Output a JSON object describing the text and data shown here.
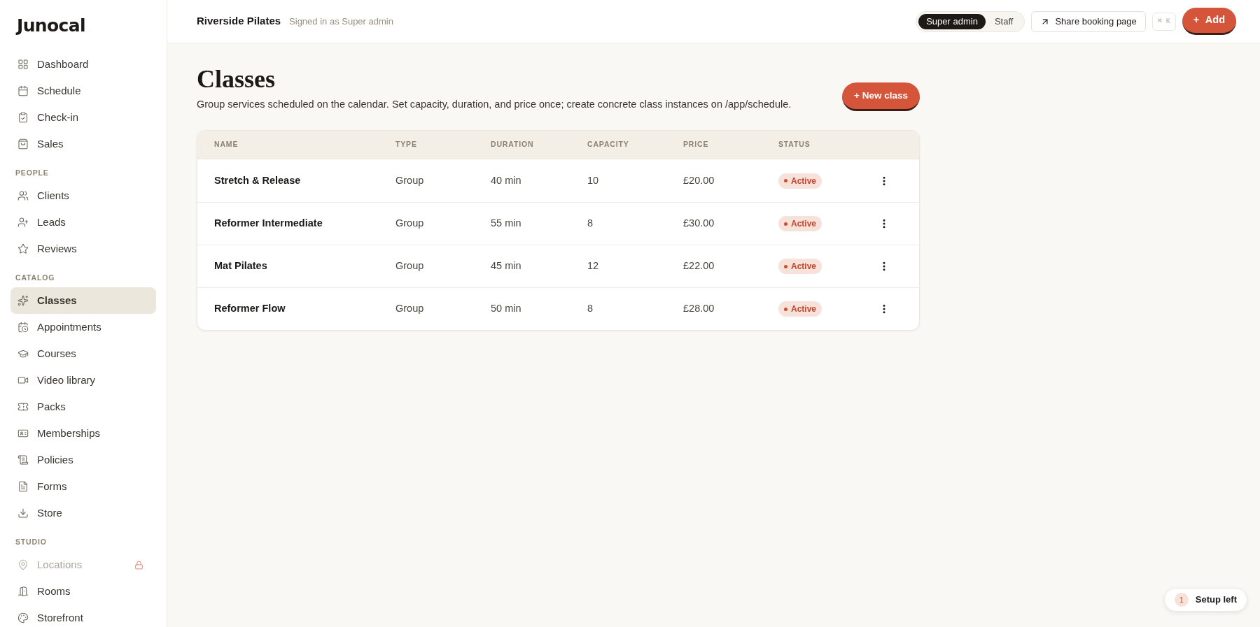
{
  "sidebar": {
    "logo": "Junocal",
    "sections": [
      {
        "items": [
          {
            "label": "Dashboard",
            "selected": false,
            "disabled": false,
            "locked": false
          },
          {
            "label": "Schedule",
            "selected": false,
            "disabled": false,
            "locked": false
          },
          {
            "label": "Check-in",
            "selected": false,
            "disabled": false,
            "locked": false
          },
          {
            "label": "Sales",
            "selected": false,
            "disabled": false,
            "locked": false
          }
        ]
      },
      {
        "title": "PEOPLE",
        "items": [
          {
            "label": "Clients",
            "selected": false,
            "disabled": false,
            "locked": false
          },
          {
            "label": "Leads",
            "selected": false,
            "disabled": false,
            "locked": false
          },
          {
            "label": "Reviews",
            "selected": false,
            "disabled": false,
            "locked": false
          }
        ]
      },
      {
        "title": "CATALOG",
        "items": [
          {
            "label": "Classes",
            "selected": true,
            "disabled": false,
            "locked": false
          },
          {
            "label": "Appointments",
            "selected": false,
            "disabled": false,
            "locked": false
          },
          {
            "label": "Courses",
            "selected": false,
            "disabled": false,
            "locked": false
          },
          {
            "label": "Video library",
            "selected": false,
            "disabled": false,
            "locked": false
          },
          {
            "label": "Packs",
            "selected": false,
            "disabled": false,
            "locked": false
          },
          {
            "label": "Memberships",
            "selected": false,
            "disabled": false,
            "locked": false
          },
          {
            "label": "Policies",
            "selected": false,
            "disabled": false,
            "locked": false
          },
          {
            "label": "Forms",
            "selected": false,
            "disabled": false,
            "locked": false
          },
          {
            "label": "Store",
            "selected": false,
            "disabled": false,
            "locked": false
          }
        ]
      },
      {
        "title": "STUDIO",
        "items": [
          {
            "label": "Locations",
            "selected": false,
            "disabled": true,
            "locked": true
          },
          {
            "label": "Rooms",
            "selected": false,
            "disabled": false,
            "locked": false
          },
          {
            "label": "Storefront",
            "selected": false,
            "disabled": false,
            "locked": false
          }
        ]
      }
    ]
  },
  "header": {
    "studio_name": "Riverside Pilates",
    "signed_in": "Signed in as Super admin",
    "roles": [
      {
        "label": "Super admin",
        "selected": true
      },
      {
        "label": "Staff",
        "selected": false
      }
    ],
    "share_button": "Share booking page",
    "shortcut": "⌘ K",
    "add_button": "+ Add"
  },
  "page": {
    "title": "Classes",
    "description": "Group services scheduled on the calendar. Set capacity, duration, and price once; create concrete class instances on /app/schedule.",
    "new_class_button": "+ New class"
  },
  "table": {
    "columns": [
      "NAME",
      "TYPE",
      "DURATION",
      "CAPACITY",
      "PRICE",
      "STATUS"
    ],
    "rows": [
      {
        "name": "Stretch & Release",
        "type": "Group",
        "duration": "40 min",
        "capacity": "10",
        "price": "£20.00",
        "status": "Active"
      },
      {
        "name": "Reformer Intermediate",
        "type": "Group",
        "duration": "55 min",
        "capacity": "8",
        "price": "£30.00",
        "status": "Active"
      },
      {
        "name": "Mat Pilates",
        "type": "Group",
        "duration": "45 min",
        "capacity": "12",
        "price": "£22.00",
        "status": "Active"
      },
      {
        "name": "Reformer Flow",
        "type": "Group",
        "duration": "50 min",
        "capacity": "8",
        "price": "£28.00",
        "status": "Active"
      }
    ]
  },
  "setup": {
    "count": "1",
    "label": "Setup left"
  }
}
